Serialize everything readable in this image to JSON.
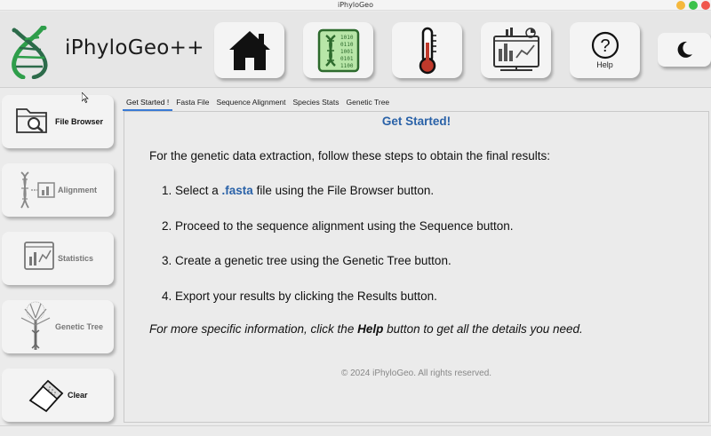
{
  "window": {
    "title": "iPhyloGeo"
  },
  "header": {
    "app_title": "iPhyloGeo++",
    "buttons": [
      {
        "icon": "home-icon"
      },
      {
        "icon": "dna-sequence-icon"
      },
      {
        "icon": "thermometer-icon"
      },
      {
        "icon": "statistics-dashboard-icon"
      },
      {
        "icon": "help-icon",
        "glyph": "?",
        "label": "Help"
      },
      {
        "icon": "moon-icon"
      }
    ]
  },
  "sidebar": {
    "items": [
      {
        "label": "File Browser",
        "icon": "folder-search-icon"
      },
      {
        "label": "Alignment",
        "icon": "dna-alignment-icon"
      },
      {
        "label": "Statistics",
        "icon": "statistics-icon"
      },
      {
        "label": "Genetic Tree",
        "icon": "genetic-tree-icon"
      },
      {
        "label": "Clear",
        "icon": "eraser-icon"
      }
    ]
  },
  "tabs": [
    {
      "label": "Get Started !"
    },
    {
      "label": "Fasta File"
    },
    {
      "label": "Sequence Alignment"
    },
    {
      "label": "Species Stats"
    },
    {
      "label": "Genetic Tree"
    }
  ],
  "main": {
    "title": "Get Started!",
    "intro": "For the genetic data extraction, follow these steps to obtain the final results:",
    "steps": {
      "s1_pre": "1. Select a ",
      "s1_highlight": ".fasta",
      "s1_post": " file using the File Browser button.",
      "s2": "2. Proceed to the sequence alignment using the Sequence button.",
      "s3": "3. Create a genetic tree using the Genetic Tree button.",
      "s4": "4. Export your results by clicking the Results button."
    },
    "note_pre": "For more specific information, click the ",
    "note_bold": "Help",
    "note_post": " button to get all the details you need.",
    "footer": "© 2024 iPhyloGeo. All rights reserved."
  },
  "colors": {
    "accent": "#2a62a8",
    "logo_green": "#2e9e4a",
    "logo_dark": "#2c6b4a",
    "tab_underline": "#3a7bd5"
  }
}
